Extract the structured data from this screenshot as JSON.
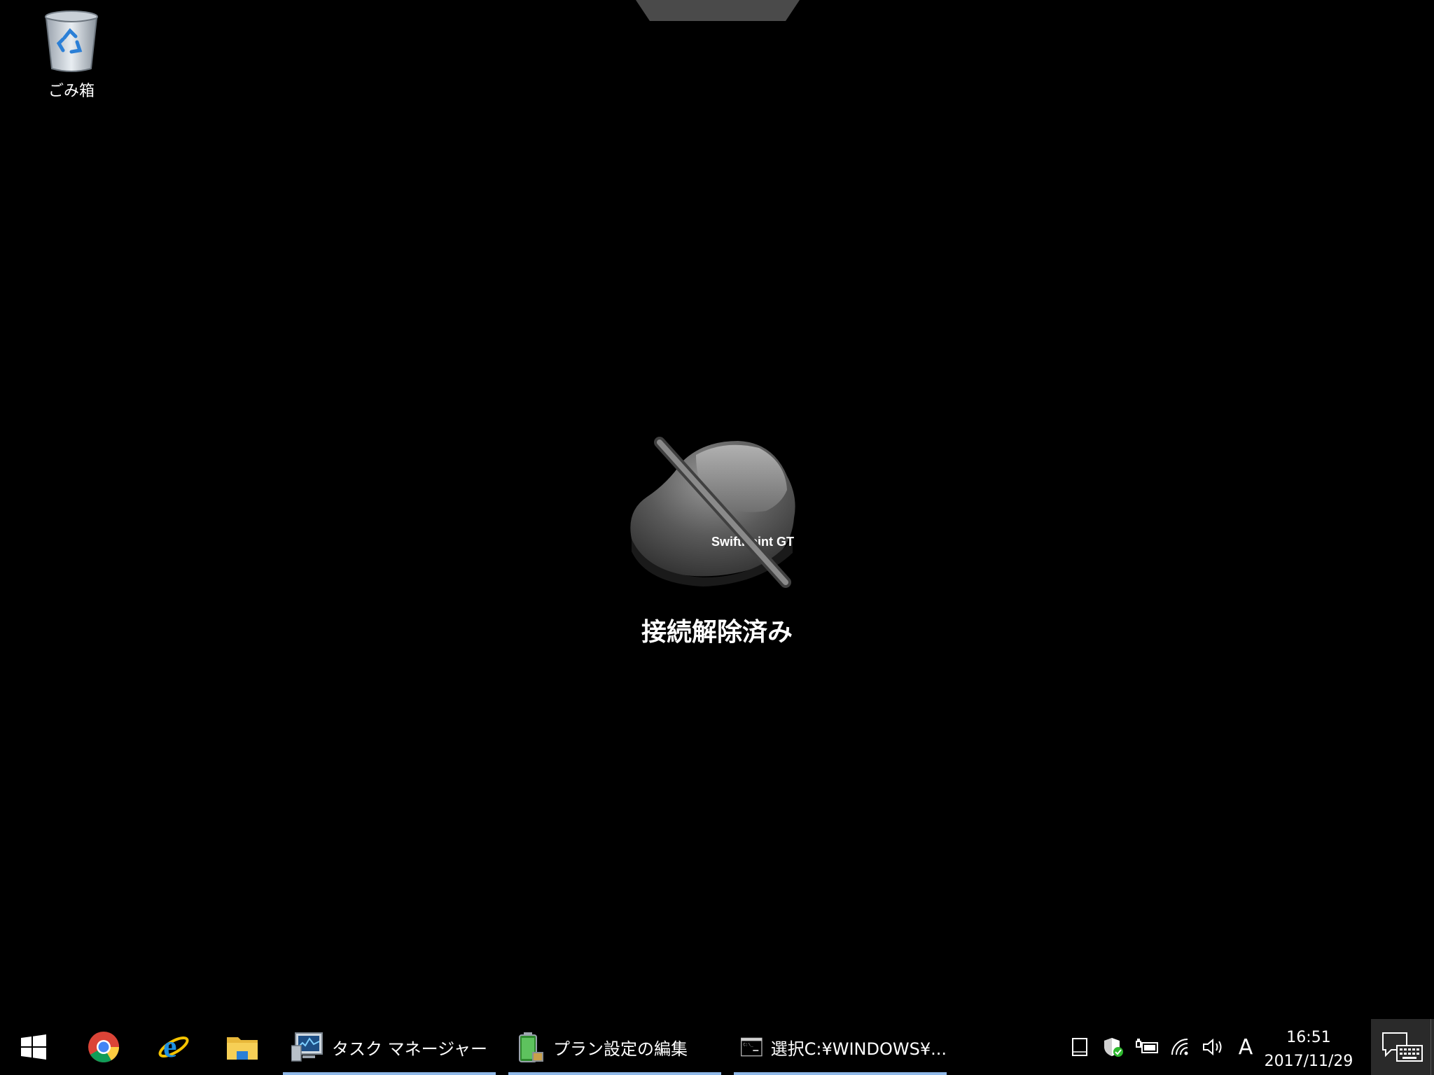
{
  "desktop": {
    "icons": [
      {
        "label": "ごみ箱",
        "icon": "recycle-bin-icon"
      }
    ],
    "overlay": {
      "device_brand": "SwiftPoint GT",
      "status": "接続解除済み"
    }
  },
  "taskbar": {
    "pinned": [
      {
        "name": "start",
        "icon": "windows-logo-icon"
      },
      {
        "name": "chrome",
        "icon": "chrome-icon"
      },
      {
        "name": "internet-explorer",
        "icon": "ie-icon"
      },
      {
        "name": "file-explorer",
        "icon": "folder-icon"
      }
    ],
    "apps": [
      {
        "label": "タスク マネージャー",
        "icon": "task-manager-icon"
      },
      {
        "label": "プラン設定の編集",
        "icon": "battery-plan-icon"
      },
      {
        "label": "選択C:¥WINDOWS¥...",
        "icon": "cmd-icon"
      }
    ],
    "tray": {
      "icons": [
        "tablet-icon",
        "defender-icon",
        "power-icon",
        "wifi-icon",
        "volume-icon"
      ],
      "ime": "A",
      "time": "16:51",
      "date": "2017/11/29"
    },
    "accent_color": "#8fb8e8"
  }
}
